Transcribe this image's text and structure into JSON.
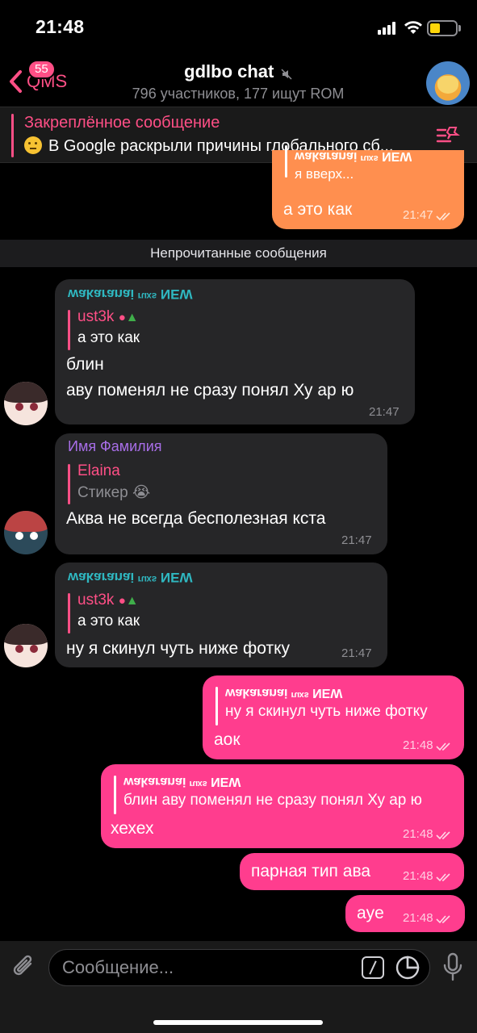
{
  "status_bar": {
    "time": "21:48"
  },
  "header": {
    "back_label": "QMS",
    "back_badge": "55",
    "title": "gdlbo chat",
    "subtitle": "796 участников, 177 ищут ROM"
  },
  "pinned": {
    "title": "Закреплённое сообщение",
    "text": "В Google раскрыли причины глобального сб..."
  },
  "divider": "Непрочитанные сообщения",
  "messages": [
    {
      "reply_name": "wakaranai ʳᵘˣˢ NEW",
      "reply_text": "я вверх...",
      "text": "а это как",
      "time": "21:47"
    },
    {
      "sender": "wakaranai ʳᵘˣˢ NEW",
      "reply_name": "ust3k",
      "reply_text": "а это как",
      "text": "блин",
      "text2": "аву поменял не сразу понял Ху ар ю",
      "time": "21:47"
    },
    {
      "sender": "Имя Фамилия",
      "reply_name": "Elaina",
      "reply_text": "Стикер 😭",
      "text": "Аква не всегда бесполезная кста",
      "time": "21:47"
    },
    {
      "sender": "wakaranai ʳᵘˣˢ NEW",
      "reply_name": "ust3k",
      "reply_text": "а это как",
      "text": "ну я скинул чуть ниже фотку",
      "time": "21:47"
    },
    {
      "reply_name": "wakaranai ʳᵘˣˢ NEW",
      "reply_text": "ну я скинул чуть ниже фотку",
      "text": "аок",
      "time": "21:48"
    },
    {
      "reply_name": "wakaranai ʳᵘˣˢ NEW",
      "reply_text": "блин аву поменял не сразу понял Ху ар ю",
      "text": "хехех",
      "time": "21:48"
    },
    {
      "text": "парная тип ава",
      "time": "21:48"
    },
    {
      "text": "aye",
      "time": "21:48"
    }
  ],
  "composer": {
    "placeholder": "Сообщение..."
  },
  "colors": {
    "accent": "#ff4f86",
    "outgoing_bubble": "#ff3d8e",
    "incoming_bubble": "#262628",
    "orange_bubble": "#ff8f4f",
    "sender_teal": "#2fb7c0",
    "sender_purple": "#a86ee8"
  },
  "icons": [
    "chevron-left-icon",
    "mute-icon",
    "pin-list-icon",
    "double-check-icon",
    "paperclip-icon",
    "command-icon",
    "sticker-icon",
    "microphone-icon",
    "apple-icon",
    "christmas-tree-icon"
  ]
}
